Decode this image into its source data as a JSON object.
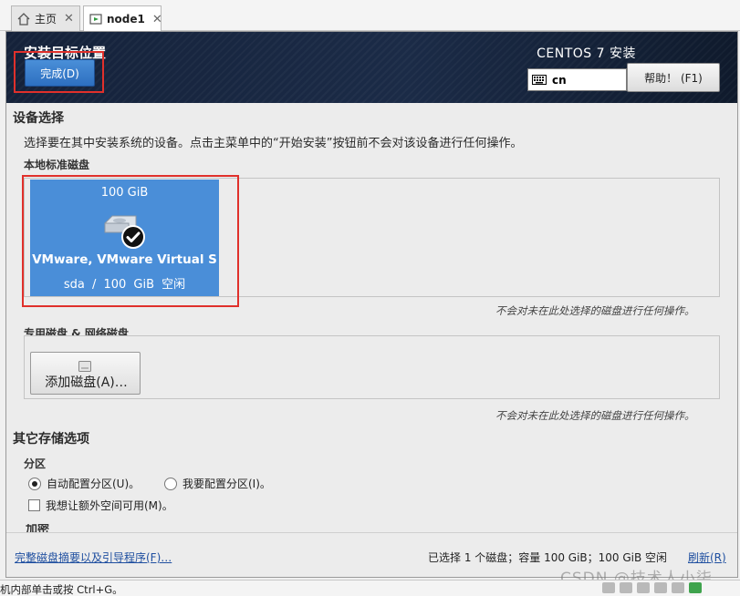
{
  "tabs": [
    {
      "label": "主页",
      "icon": "home-icon",
      "active": false
    },
    {
      "label": "node1",
      "icon": "vm-icon",
      "active": true
    }
  ],
  "header": {
    "title": "安装目标位置",
    "done_label": "完成(D)",
    "product": "CENTOS 7 安装",
    "keyboard_layout": "cn",
    "help_label": "帮助！ (F1)"
  },
  "device_selection": {
    "title": "设备选择",
    "description": "选择要在其中安装系统的设备。点击主菜单中的“开始安装”按钮前不会对该设备进行任何操作。",
    "local_disks_title": "本地标准磁盘",
    "disk": {
      "size": "100 GiB",
      "name": "VMware, VMware Virtual S",
      "device": "sda",
      "separator": "/",
      "free": "100 GiB 空闲",
      "selected": true
    },
    "note": "不会对未在此处选择的磁盘进行任何操作。",
    "specialized_title": "专用磁盘 & 网络磁盘",
    "add_disk_label": "添加磁盘(A)…",
    "specialized_note": "不会对未在此处选择的磁盘进行任何操作。"
  },
  "other_storage": {
    "title": "其它存储选项",
    "partition_title": "分区",
    "auto_partition": "自动配置分区(U)。",
    "manual_partition": "我要配置分区(I)。",
    "extra_space": "我想让额外空间可用(M)。",
    "encryption_title": "加密"
  },
  "bottom": {
    "summary_link": "完整磁盘摘要以及引导程序(F)…",
    "status": "已选择 1 个磁盘；容量 100 GiB；100 GiB 空闲",
    "refresh_link": "刷新(R)"
  },
  "vm_status": {
    "hint": "机内部单击或按 Ctrl+G。",
    "watermark": "CSDN @技术人小柒"
  },
  "colors": {
    "accent": "#4a8ed8",
    "header_bg": "#1b2b47",
    "highlight": "#e0302b",
    "link": "#1f4fa0"
  }
}
